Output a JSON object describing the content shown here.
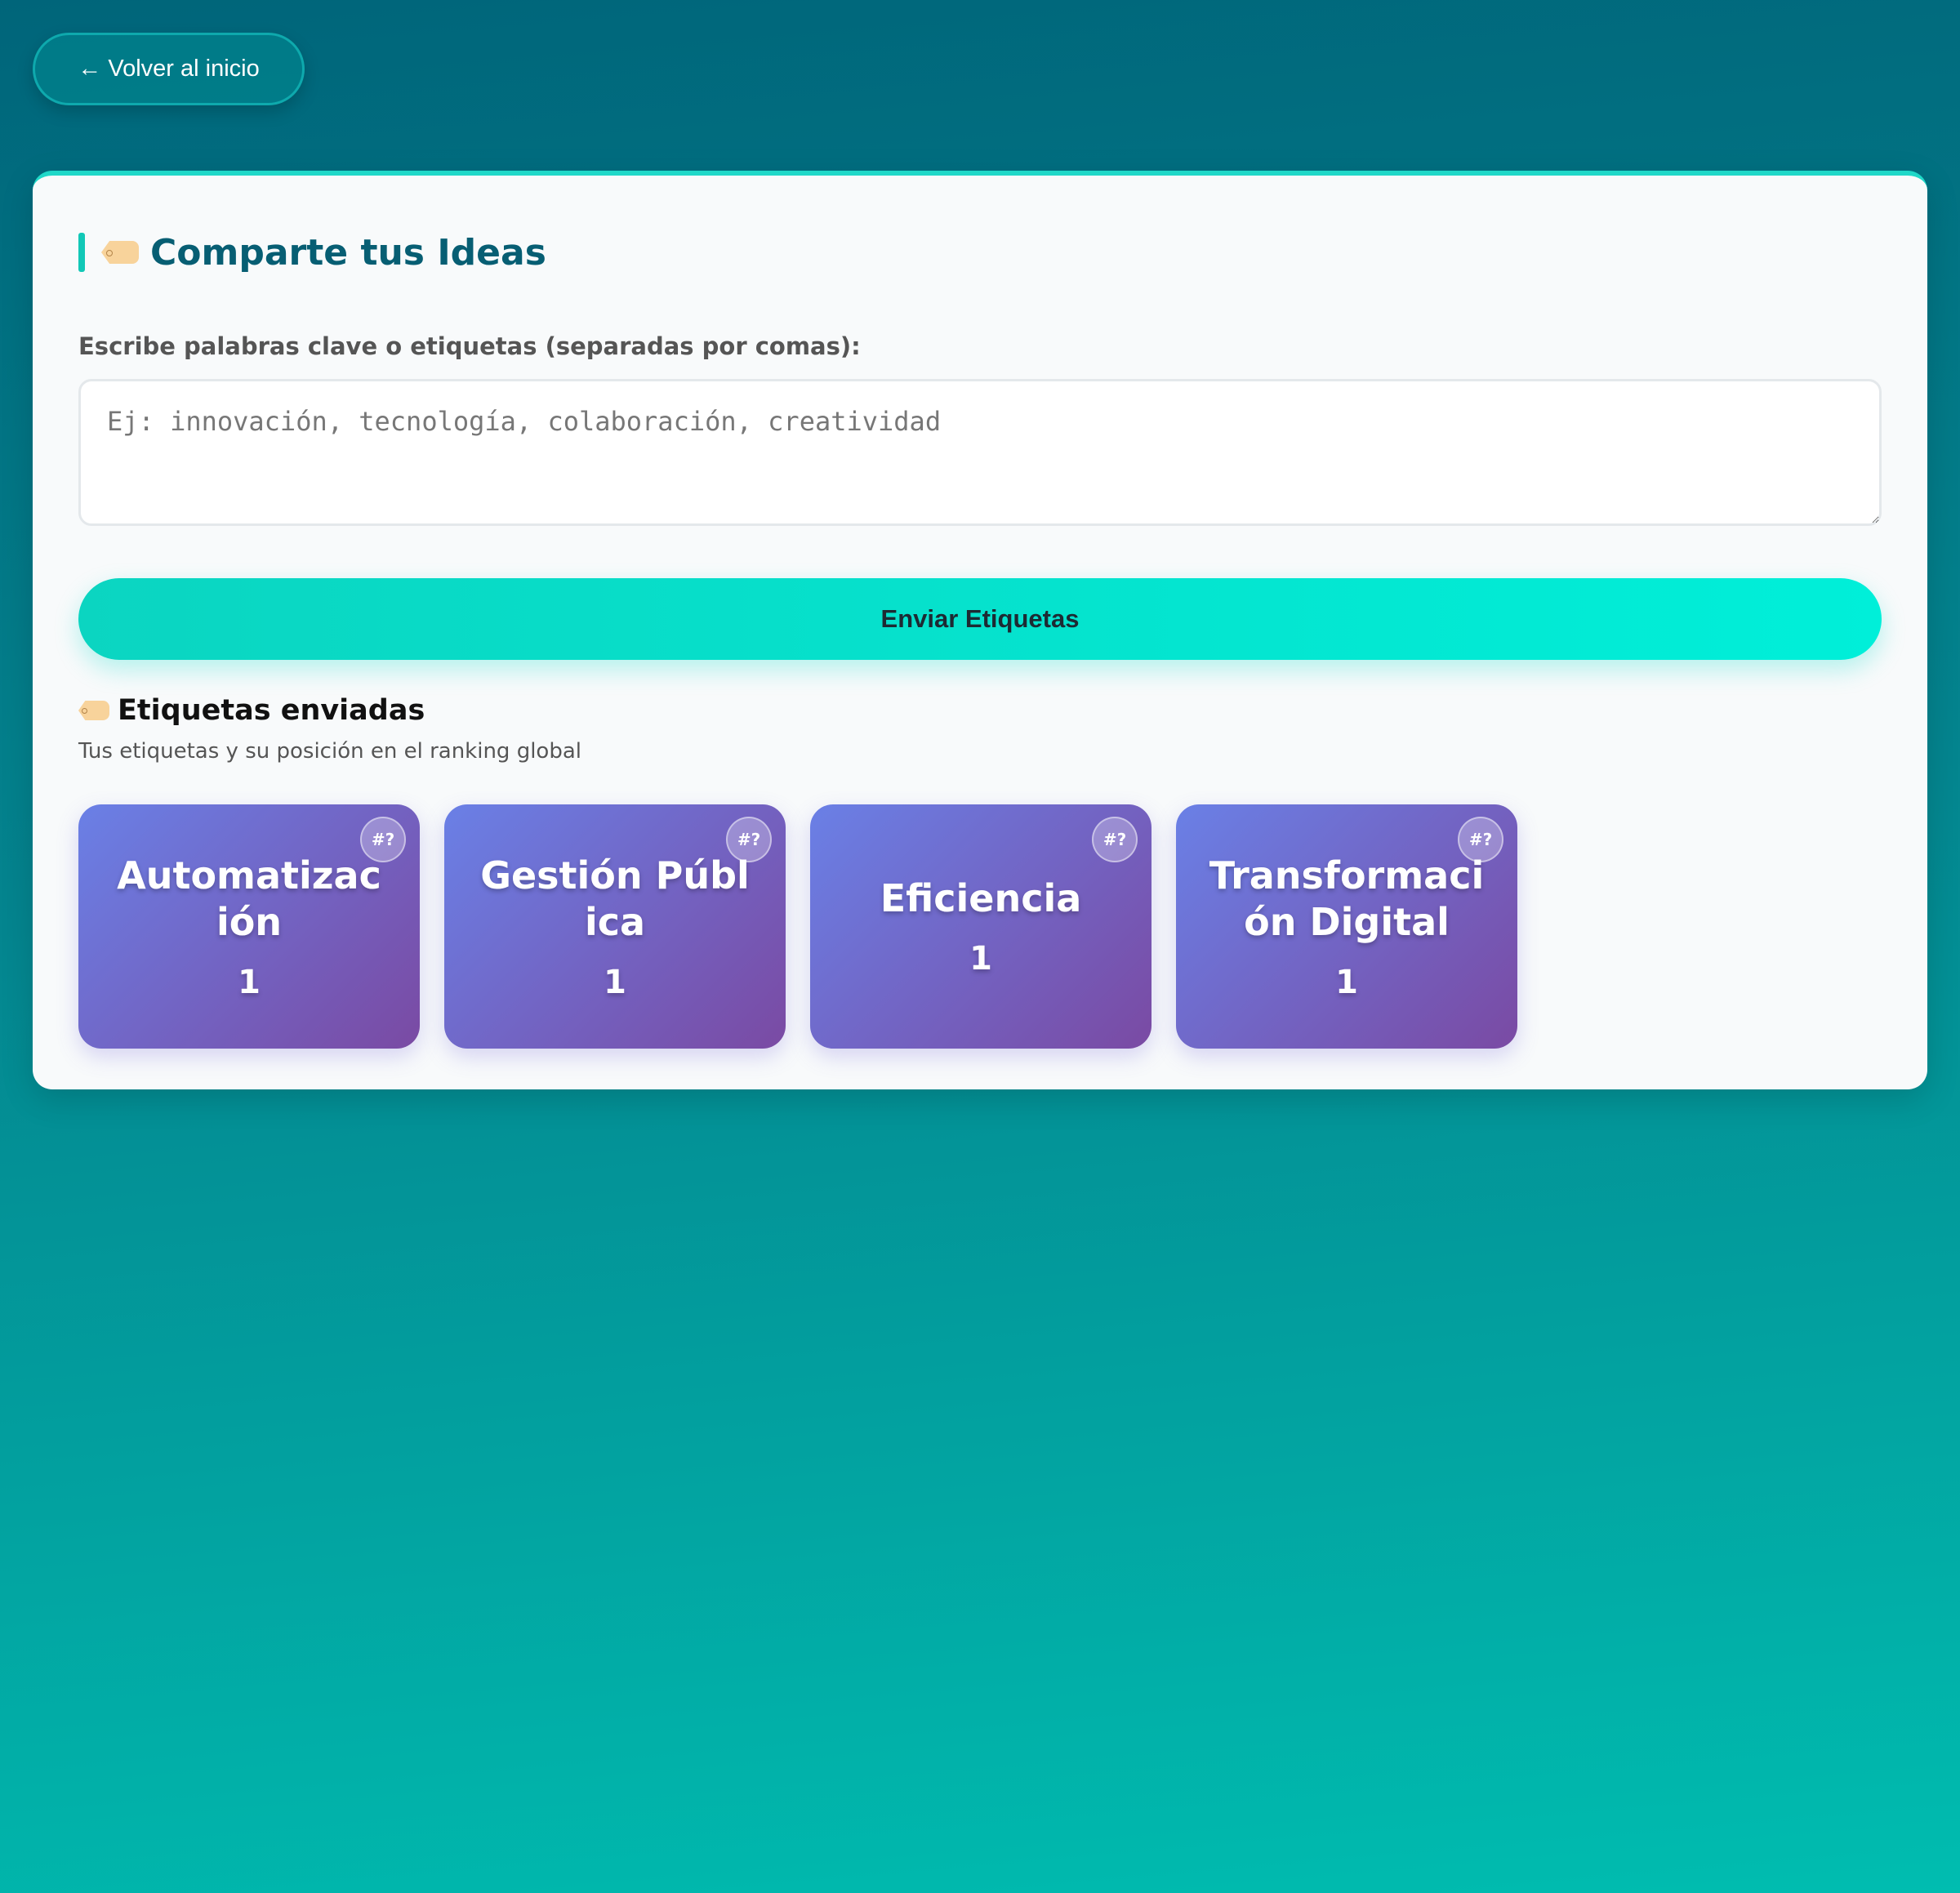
{
  "nav": {
    "back_label": "← Volver al inicio"
  },
  "form": {
    "title": "Comparte tus Ideas",
    "field_label": "Escribe palabras clave o etiquetas (separadas por comas):",
    "textarea_placeholder": "Ej: innovación, tecnología, colaboración, creatividad",
    "textarea_value": "",
    "submit_label": "Enviar Etiquetas"
  },
  "sent": {
    "title": "Etiquetas enviadas",
    "subtitle": "Tus etiquetas y su posición en el ranking global",
    "tags": [
      {
        "name": "Automatización",
        "count": "1",
        "rank": "#?"
      },
      {
        "name": "Gestión Pública",
        "count": "1",
        "rank": "#?"
      },
      {
        "name": "Eficiencia",
        "count": "1",
        "rank": "#?"
      },
      {
        "name": "Transformación Digital",
        "count": "1",
        "rank": "#?"
      }
    ]
  },
  "colors": {
    "accent": "#12c8b7",
    "title": "#075e73",
    "tag_card_start": "#6a80e6",
    "tag_card_end": "#7a4aa3",
    "tag_icon": "#f8d39b"
  },
  "icons": {
    "title_icon": "tag-icon",
    "sent_icon": "tag-icon"
  }
}
